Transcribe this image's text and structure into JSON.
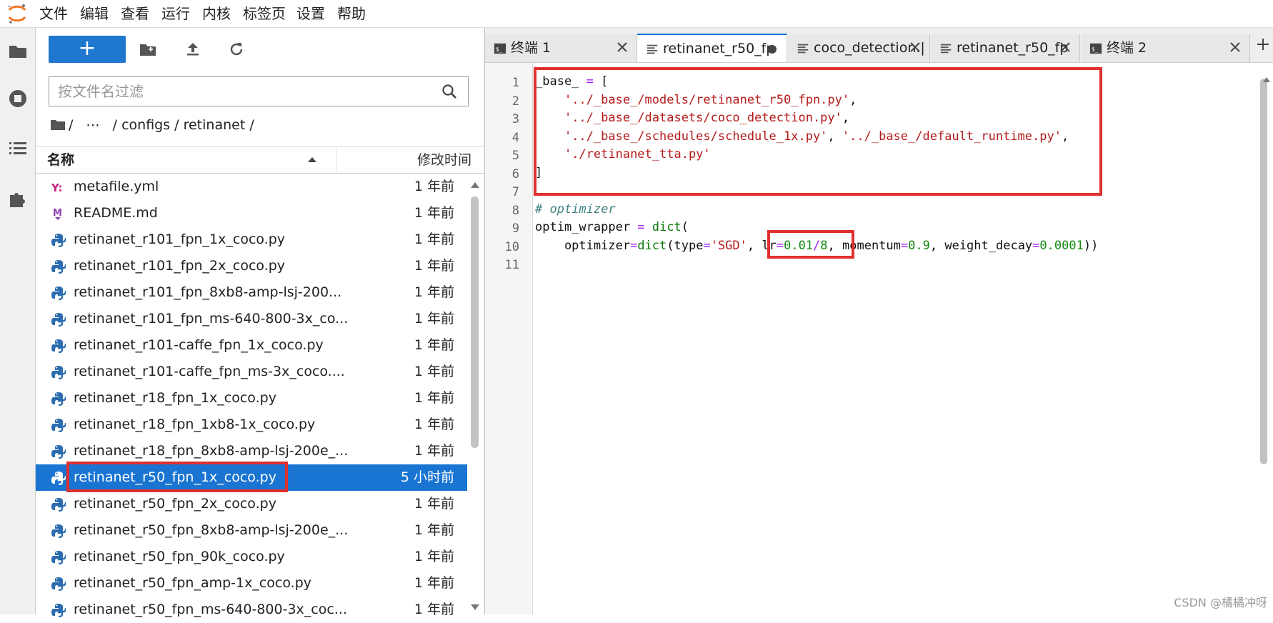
{
  "menubar": {
    "items": [
      "文件",
      "编辑",
      "查看",
      "运行",
      "内核",
      "标签页",
      "设置",
      "帮助"
    ]
  },
  "filebrowser": {
    "new_label": "+",
    "filter_placeholder": "按文件名过滤",
    "breadcrumb": "/   ⋯   / configs / retinanet /",
    "col_name": "名称",
    "col_modified": "修改时间",
    "files": [
      {
        "name": "metafile.yml",
        "time": "1 年前",
        "icon": "yaml-icon"
      },
      {
        "name": "README.md",
        "time": "1 年前",
        "icon": "markdown-icon"
      },
      {
        "name": "retinanet_r101_fpn_1x_coco.py",
        "time": "1 年前",
        "icon": "python-icon"
      },
      {
        "name": "retinanet_r101_fpn_2x_coco.py",
        "time": "1 年前",
        "icon": "python-icon"
      },
      {
        "name": "retinanet_r101_fpn_8xb8-amp-lsj-200...",
        "time": "1 年前",
        "icon": "python-icon"
      },
      {
        "name": "retinanet_r101_fpn_ms-640-800-3x_co...",
        "time": "1 年前",
        "icon": "python-icon"
      },
      {
        "name": "retinanet_r101-caffe_fpn_1x_coco.py",
        "time": "1 年前",
        "icon": "python-icon"
      },
      {
        "name": "retinanet_r101-caffe_fpn_ms-3x_coco....",
        "time": "1 年前",
        "icon": "python-icon"
      },
      {
        "name": "retinanet_r18_fpn_1x_coco.py",
        "time": "1 年前",
        "icon": "python-icon"
      },
      {
        "name": "retinanet_r18_fpn_1xb8-1x_coco.py",
        "time": "1 年前",
        "icon": "python-icon"
      },
      {
        "name": "retinanet_r18_fpn_8xb8-amp-lsj-200e_...",
        "time": "1 年前",
        "icon": "python-icon"
      },
      {
        "name": "retinanet_r50_fpn_1x_coco.py",
        "time": "5 小时前",
        "icon": "python-icon",
        "selected": true
      },
      {
        "name": "retinanet_r50_fpn_2x_coco.py",
        "time": "1 年前",
        "icon": "python-icon"
      },
      {
        "name": "retinanet_r50_fpn_8xb8-amp-lsj-200e_...",
        "time": "1 年前",
        "icon": "python-icon"
      },
      {
        "name": "retinanet_r50_fpn_90k_coco.py",
        "time": "1 年前",
        "icon": "python-icon"
      },
      {
        "name": "retinanet_r50_fpn_amp-1x_coco.py",
        "time": "1 年前",
        "icon": "python-icon"
      },
      {
        "name": "retinanet_r50_fpn_ms-640-800-3x_coc...",
        "time": "1 年前",
        "icon": "python-icon"
      }
    ]
  },
  "tabs": [
    {
      "label": "终端 1",
      "icon": "terminal-icon",
      "close": true
    },
    {
      "label": "retinanet_r50_fp",
      "icon": "file-text-icon",
      "active": true,
      "dirty": true
    },
    {
      "label": "coco_detection.|",
      "icon": "file-text-icon",
      "close": true
    },
    {
      "label": "retinanet_r50_fp",
      "icon": "file-text-icon",
      "close": true
    },
    {
      "label": "终端 2",
      "icon": "terminal-icon",
      "close": true
    }
  ],
  "editor": {
    "line_numbers": [
      "1",
      "2",
      "3",
      "4",
      "5",
      "6",
      "7",
      "8",
      "9",
      "10",
      "11"
    ],
    "lines": [
      [
        {
          "t": "_base_ ",
          "c": ""
        },
        {
          "t": "=",
          "c": "op"
        },
        {
          "t": " [",
          "c": ""
        }
      ],
      [
        {
          "t": "    ",
          "c": ""
        },
        {
          "t": "'../_base_/models/retinanet_r50_fpn.py'",
          "c": "str"
        },
        {
          "t": ",",
          "c": ""
        }
      ],
      [
        {
          "t": "    ",
          "c": ""
        },
        {
          "t": "'../_base_/datasets/coco_detection.py'",
          "c": "str"
        },
        {
          "t": ",",
          "c": ""
        }
      ],
      [
        {
          "t": "    ",
          "c": ""
        },
        {
          "t": "'../_base_/schedules/schedule_1x.py'",
          "c": "str"
        },
        {
          "t": ", ",
          "c": ""
        },
        {
          "t": "'../_base_/default_runtime.py'",
          "c": "str"
        },
        {
          "t": ",",
          "c": ""
        }
      ],
      [
        {
          "t": "    ",
          "c": ""
        },
        {
          "t": "'./retinanet_tta.py'",
          "c": "str"
        }
      ],
      [
        {
          "t": "]",
          "c": ""
        }
      ],
      [],
      [
        {
          "t": "# optimizer",
          "c": "cmt"
        }
      ],
      [
        {
          "t": "optim_wrapper ",
          "c": ""
        },
        {
          "t": "=",
          "c": "op"
        },
        {
          "t": " ",
          "c": ""
        },
        {
          "t": "dict",
          "c": "fn"
        },
        {
          "t": "(",
          "c": ""
        }
      ],
      [
        {
          "t": "    optimizer",
          "c": ""
        },
        {
          "t": "=",
          "c": "op"
        },
        {
          "t": "dict",
          "c": "fn"
        },
        {
          "t": "(type",
          "c": ""
        },
        {
          "t": "=",
          "c": "op"
        },
        {
          "t": "'SGD'",
          "c": "str"
        },
        {
          "t": ", lr",
          "c": ""
        },
        {
          "t": "=",
          "c": "op"
        },
        {
          "t": "0.01",
          "c": "num"
        },
        {
          "t": "/",
          "c": "op"
        },
        {
          "t": "8",
          "c": "num"
        },
        {
          "t": ", momentum",
          "c": ""
        },
        {
          "t": "=",
          "c": "op"
        },
        {
          "t": "0.9",
          "c": "num"
        },
        {
          "t": ", weight_decay",
          "c": ""
        },
        {
          "t": "=",
          "c": "op"
        },
        {
          "t": "0.0001",
          "c": "num"
        },
        {
          "t": "))",
          "c": ""
        }
      ],
      []
    ]
  },
  "watermark": "CSDN @橘橘冲呀",
  "colors": {
    "accent": "#1a75d2",
    "highlight": "#e03030"
  }
}
